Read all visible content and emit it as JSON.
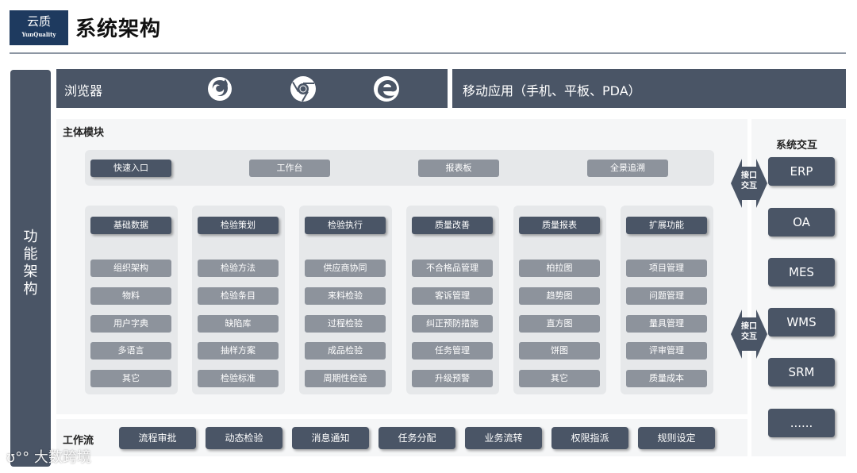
{
  "header": {
    "logo_cn": "云质",
    "logo_en": "YunQuality",
    "title": "系统架构"
  },
  "side_label": "功能架构",
  "top_bars": {
    "browser_label": "浏览器",
    "mobile_label": "移动应用（手机、平板、PDA）",
    "browser_icons": [
      "firefox-icon",
      "chrome-icon",
      "edge-icon"
    ]
  },
  "main": {
    "title": "主体模块",
    "entries": [
      "快速入口",
      "工作台",
      "报表板",
      "全景追溯"
    ],
    "columns": [
      {
        "header": "基础数据",
        "items": [
          "组织架构",
          "物料",
          "用户字典",
          "多语言",
          "其它"
        ]
      },
      {
        "header": "检验策划",
        "items": [
          "检验方法",
          "检验条目",
          "缺陷库",
          "抽样方案",
          "检验标准"
        ]
      },
      {
        "header": "检验执行",
        "items": [
          "供应商协同",
          "来料检验",
          "过程检验",
          "成品检验",
          "周期性检验"
        ]
      },
      {
        "header": "质量改善",
        "items": [
          "不合格品管理",
          "客诉管理",
          "纠正预防措施",
          "任务管理",
          "升级预警"
        ]
      },
      {
        "header": "质量报表",
        "items": [
          "柏拉图",
          "趋势图",
          "直方图",
          "饼图",
          "其它"
        ]
      },
      {
        "header": "扩展功能",
        "items": [
          "项目管理",
          "问题管理",
          "量具管理",
          "评审管理",
          "质量成本"
        ]
      }
    ]
  },
  "workflow": {
    "title": "工作流",
    "items": [
      "流程审批",
      "动态检验",
      "消息通知",
      "任务分配",
      "业务流转",
      "权限指派",
      "规则设定"
    ]
  },
  "system": {
    "title": "系统交互",
    "items": [
      "ERP",
      "OA",
      "MES",
      "WMS",
      "SRM",
      "......"
    ],
    "arrow_label": "接口交互"
  },
  "watermark": "大数跨境",
  "colors": {
    "dark": "#4a5566",
    "logo": "#1e3a5f",
    "panel": "#f5f6f7",
    "column": "#e6e8ea"
  }
}
